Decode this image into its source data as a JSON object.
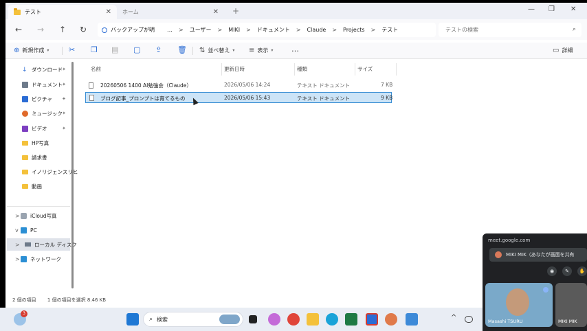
{
  "tabs": [
    {
      "label": "テスト",
      "active": true,
      "close": "✕"
    },
    {
      "label": "ホーム",
      "active": false,
      "close": "✕"
    }
  ],
  "new_tab_symbol": "+",
  "window_controls": {
    "minimize": "—",
    "maximize": "❐",
    "close": "✕"
  },
  "nav": {
    "back": "←",
    "forward": "→",
    "up": "↑",
    "refresh": "↻"
  },
  "breadcrumb": {
    "root": "バックアップが明",
    "items": [
      "…",
      "ユーザー",
      "MIKI",
      "ドキュメント",
      "Claude",
      "Projects",
      "テスト"
    ],
    "separator": ">"
  },
  "search": {
    "placeholder": "テストの検索",
    "icon": "⌕"
  },
  "commandbar": {
    "new_label": "新規作成",
    "sort_label": "並べ替え",
    "view_label": "表示",
    "more": "…",
    "details_label": "詳細"
  },
  "sidebar": {
    "quick_access": [
      {
        "label": "ダウンロード",
        "pinned": true,
        "icon": "download-icon",
        "color": "#2b6cd4"
      },
      {
        "label": "ドキュメント",
        "pinned": true,
        "icon": "document-icon",
        "color": "#6d7a8a"
      },
      {
        "label": "ピクチャ",
        "pinned": true,
        "icon": "picture-icon",
        "color": "#2b6cd4"
      },
      {
        "label": "ミュージック",
        "pinned": true,
        "icon": "music-icon",
        "color": "#e06a2b"
      },
      {
        "label": "ビデオ",
        "pinned": true,
        "icon": "video-icon",
        "color": "#7d3fc1"
      },
      {
        "label": "HP写真",
        "pinned": false,
        "icon": "folder-icon",
        "color": "#f4c13b"
      },
      {
        "label": "請求書",
        "pinned": false,
        "icon": "folder-icon",
        "color": "#f4c13b"
      },
      {
        "label": "イノリジェンスリヒ",
        "pinned": false,
        "icon": "folder-icon",
        "color": "#f4c13b"
      },
      {
        "label": "動画",
        "pinned": false,
        "icon": "folder-icon",
        "color": "#f4c13b"
      }
    ],
    "tree": [
      {
        "label": "iCloud写真",
        "chev": ">",
        "icon": "icloud-photos-icon"
      },
      {
        "label": "PC",
        "chev": "v",
        "icon": "pc-icon"
      },
      {
        "label": "ローカル ディスク",
        "chev": ">",
        "icon": "disk-icon",
        "selected": true
      },
      {
        "label": "ネットワーク",
        "chev": ">",
        "icon": "network-icon"
      }
    ],
    "pin_symbol": "📌"
  },
  "filelist": {
    "columns": [
      "名前",
      "更新日時",
      "種類",
      "サイズ"
    ],
    "rows": [
      {
        "name": "20260506 1400 AI勉強会（Claude）",
        "date": "2026/05/06 14:24",
        "type": "テキスト ドキュメント",
        "size": "7 KB",
        "selected": false
      },
      {
        "name": "ブログ記事_プロンプトは育てるもの",
        "date": "2026/05/06 15:43",
        "type": "テキスト ドキュメント",
        "size": "9 KB",
        "selected": true
      }
    ]
  },
  "status": {
    "count": "2 個の項目",
    "selection": "1 個の項目を選択  8.46 KB"
  },
  "taskbar": {
    "search_label": "検索",
    "weather_badge": "3",
    "tray_chevron": "^"
  },
  "meet": {
    "url": "meet.google.com",
    "bar_text": "MIKI MIK（あなたが画面を共有",
    "tile1_name": "Masashi TSURU",
    "tile2_name": "MIKI MIK"
  }
}
